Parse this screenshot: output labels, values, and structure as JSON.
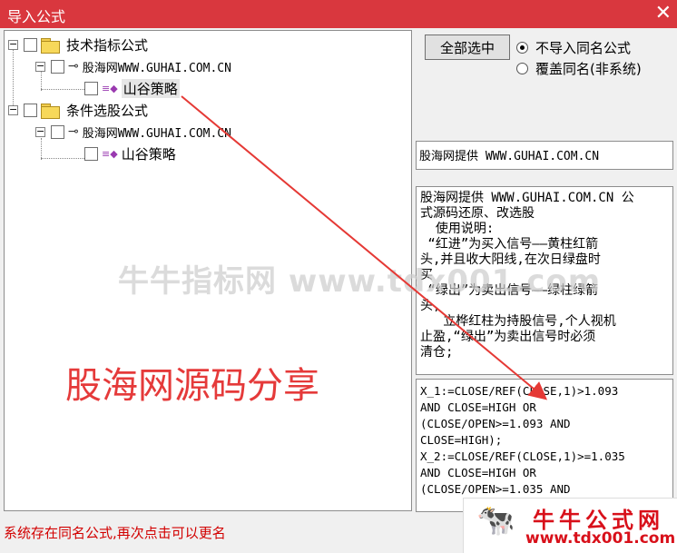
{
  "window": {
    "title": "导入公式",
    "close_glyph": "✕"
  },
  "tree": {
    "group1": {
      "expander": "−",
      "label": "技术指标公式"
    },
    "group1_sub": {
      "expander": "−",
      "label": "股海网WWW.GUHAI.COM.CN"
    },
    "group1_leaf": {
      "label": "山谷策略"
    },
    "group2": {
      "expander": "−",
      "label": "条件选股公式"
    },
    "group2_sub": {
      "expander": "−",
      "label": "股海网WWW.GUHAI.COM.CN"
    },
    "group2_leaf": {
      "label": "山谷策略"
    }
  },
  "buttons": {
    "select_all": "全部选中"
  },
  "radios": [
    {
      "label": "不导入同名公式",
      "checked": true
    },
    {
      "label": "覆盖同名(非系统)",
      "checked": false
    }
  ],
  "provider_text": "股海网提供 WWW.GUHAI.COM.CN",
  "description_lines": [
    "股海网提供 WWW.GUHAI.COM.CN 公",
    "式源码还原、改选股",
    "  使用说明:",
    " “红进”为买入信号——黄柱红箭",
    "头,并且收大阳线,在次日绿盘时",
    "买",
    " “绿出”为卖出信号——绿柱绿箭",
    "头,",
    "   立桦红柱为持股信号,个人视机",
    "止盈,“绿出”为卖出信号时必须",
    "清仓;"
  ],
  "code_lines": [
    "X_1:=CLOSE/REF(CLOSE,1)>1.093",
    "AND CLOSE=HIGH OR",
    "(CLOSE/OPEN>=1.093 AND",
    "CLOSE=HIGH);",
    "X_2:=CLOSE/REF(CLOSE,1)>=1.035",
    "AND CLOSE=HIGH OR",
    "(CLOSE/OPEN>=1.035 AND"
  ],
  "status_text": "系统存在同名公式,再次点击可以更名",
  "overlay": {
    "watermark": "牛牛指标网 www.tdx001.com",
    "share_text": "股海网源码分享",
    "badge_cn": "牛牛公式网",
    "badge_url": "www.tdx001.com",
    "arrow_color": "#e53935"
  },
  "colors": {
    "title_bar": "#d9373e",
    "status_red": "#d20000",
    "accent_red": "#e53a3a"
  }
}
